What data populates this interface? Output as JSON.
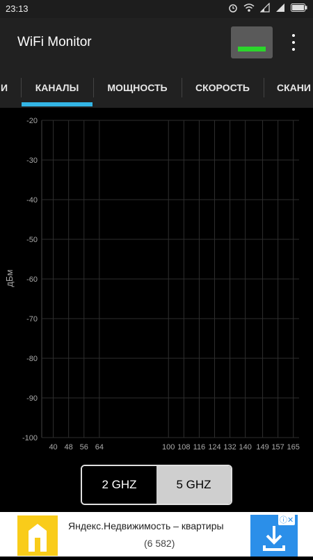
{
  "status": {
    "time": "23:13"
  },
  "appbar": {
    "title": "WiFi Monitor"
  },
  "tabs": [
    {
      "label": "И"
    },
    {
      "label": "КАНАЛЫ"
    },
    {
      "label": "МОЩНОСТЬ"
    },
    {
      "label": "СКОРОСТЬ"
    },
    {
      "label": "СКАНИ"
    }
  ],
  "colors": {
    "accent": "#33b5e5",
    "signal": "#2bd62b",
    "ad_blue": "#2b8fe9"
  },
  "chart_data": {
    "type": "line",
    "ylabel": "дБм",
    "ylim": [
      -100,
      -20
    ],
    "yticks": [
      -20,
      -30,
      -40,
      -50,
      -60,
      -70,
      -80,
      -90,
      -100
    ],
    "xticks": [
      "40",
      "48",
      "56",
      "64",
      "100",
      "108",
      "116",
      "124",
      "132",
      "140",
      "149",
      "157",
      "165"
    ],
    "series": [],
    "grid": true
  },
  "band_toggle": {
    "options": [
      "2 GHZ",
      "5 GHZ"
    ],
    "selected": "2 GHZ"
  },
  "ad": {
    "title": "Яндекс.Недвижимость – квартиры",
    "count": "(6 582)"
  }
}
